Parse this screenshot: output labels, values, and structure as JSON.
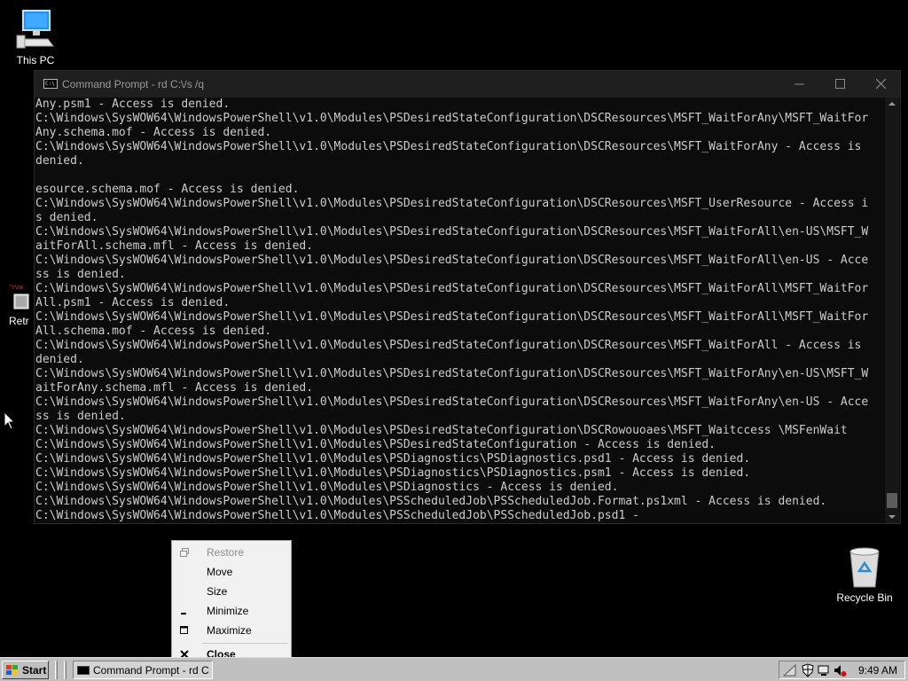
{
  "desktop": {
    "this_pc_label": "This PC",
    "recycle_bin_label": "Recycle Bin",
    "retro_label": "Retr"
  },
  "console": {
    "title": "Command Prompt - rd  C:\\/s /q",
    "app_icon_text": "C:\\",
    "lines": [
      "Any.psm1 - Access is denied.",
      "C:\\Windows\\SysWOW64\\WindowsPowerShell\\v1.0\\Modules\\PSDesiredStateConfiguration\\DSCResources\\MSFT_WaitForAny\\MSFT_WaitFor",
      "Any.schema.mof - Access is denied.",
      "C:\\Windows\\SysWOW64\\WindowsPowerShell\\v1.0\\Modules\\PSDesiredStateConfiguration\\DSCResources\\MSFT_WaitForAny - Access is",
      "denied.",
      "",
      "esource.schema.mof - Access is denied.",
      "C:\\Windows\\SysWOW64\\WindowsPowerShell\\v1.0\\Modules\\PSDesiredStateConfiguration\\DSCResources\\MSFT_UserResource - Access i",
      "s denied.",
      "C:\\Windows\\SysWOW64\\WindowsPowerShell\\v1.0\\Modules\\PSDesiredStateConfiguration\\DSCResources\\MSFT_WaitForAll\\en-US\\MSFT_W",
      "aitForAll.schema.mfl - Access is denied.",
      "C:\\Windows\\SysWOW64\\WindowsPowerShell\\v1.0\\Modules\\PSDesiredStateConfiguration\\DSCResources\\MSFT_WaitForAll\\en-US - Acce",
      "ss is denied.",
      "C:\\Windows\\SysWOW64\\WindowsPowerShell\\v1.0\\Modules\\PSDesiredStateConfiguration\\DSCResources\\MSFT_WaitForAll\\MSFT_WaitFor",
      "All.psm1 - Access is denied.",
      "C:\\Windows\\SysWOW64\\WindowsPowerShell\\v1.0\\Modules\\PSDesiredStateConfiguration\\DSCResources\\MSFT_WaitForAll\\MSFT_WaitFor",
      "All.schema.mof - Access is denied.",
      "C:\\Windows\\SysWOW64\\WindowsPowerShell\\v1.0\\Modules\\PSDesiredStateConfiguration\\DSCResources\\MSFT_WaitForAll - Access is",
      "denied.",
      "C:\\Windows\\SysWOW64\\WindowsPowerShell\\v1.0\\Modules\\PSDesiredStateConfiguration\\DSCResources\\MSFT_WaitForAny\\en-US\\MSFT_W",
      "aitForAny.schema.mfl - Access is denied.",
      "C:\\Windows\\SysWOW64\\WindowsPowerShell\\v1.0\\Modules\\PSDesiredStateConfiguration\\DSCResources\\MSFT_WaitForAny\\en-US - Acce",
      "ss is denied.",
      "C:\\Windows\\SysWOW64\\WindowsPowerShell\\v1.0\\Modules\\PSDesiredStateConfiguration\\DSCRowouoaes\\MSFT_Waitccess \\MSFenWait",
      "C:\\Windows\\SysWOW64\\WindowsPowerShell\\v1.0\\Modules\\PSDesiredStateConfiguration - Access is denied.",
      "C:\\Windows\\SysWOW64\\WindowsPowerShell\\v1.0\\Modules\\PSDiagnostics\\PSDiagnostics.psd1 - Access is denied.",
      "C:\\Windows\\SysWOW64\\WindowsPowerShell\\v1.0\\Modules\\PSDiagnostics\\PSDiagnostics.psm1 - Access is denied.",
      "C:\\Windows\\SysWOW64\\WindowsPowerShell\\v1.0\\Modules\\PSDiagnostics - Access is denied.",
      "C:\\Windows\\SysWOW64\\WindowsPowerShell\\v1.0\\Modules\\PSScheduledJob\\PSScheduledJob.Format.ps1xml - Access is denied.",
      "C:\\Windows\\SysWOW64\\WindowsPowerShell\\v1.0\\Modules\\PSScheduledJob\\PSScheduledJob.psd1 -"
    ],
    "colors": {
      "background": "#0c0c0c",
      "text": "#cccccc",
      "titlebar": "#1f1f1f"
    }
  },
  "system_menu": {
    "items": [
      {
        "label": "Restore",
        "icon": "restore-icon",
        "disabled": true
      },
      {
        "label": "Move",
        "icon": "",
        "disabled": false
      },
      {
        "label": "Size",
        "icon": "",
        "disabled": false
      },
      {
        "label": "Minimize",
        "icon": "minimize-icon",
        "disabled": false
      },
      {
        "label": "Maximize",
        "icon": "maximize-icon",
        "disabled": false
      },
      {
        "label": "Close",
        "icon": "close-icon",
        "disabled": false,
        "bold": true
      }
    ]
  },
  "taskbar": {
    "start_label": "Start",
    "task_console_label": "Command Prompt - rd  C:\\...",
    "clock": "9:49 AM",
    "colors": {
      "face": "#c0c0c0"
    }
  }
}
